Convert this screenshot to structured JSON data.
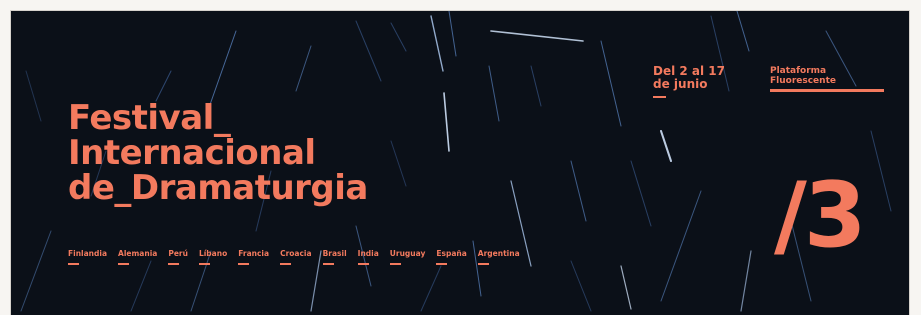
{
  "festival": {
    "title_lines": [
      "Festival_",
      "Internacional",
      "de_Dramaturgia"
    ],
    "countries": [
      "Finlandia",
      "Alemania",
      "Perú",
      "Líbano",
      "Francia",
      "Croacia",
      "Brasil",
      "India",
      "Uruguay",
      "España",
      "Argentina"
    ],
    "dates": [
      "Del 2 al 17",
      "de junio"
    ],
    "platform": [
      "Plataforma",
      "Fluorescente"
    ],
    "edition": "/3"
  },
  "colors": {
    "background": "#0b1018",
    "accent": "#f37a5e",
    "streaks": "#5b86c4"
  }
}
